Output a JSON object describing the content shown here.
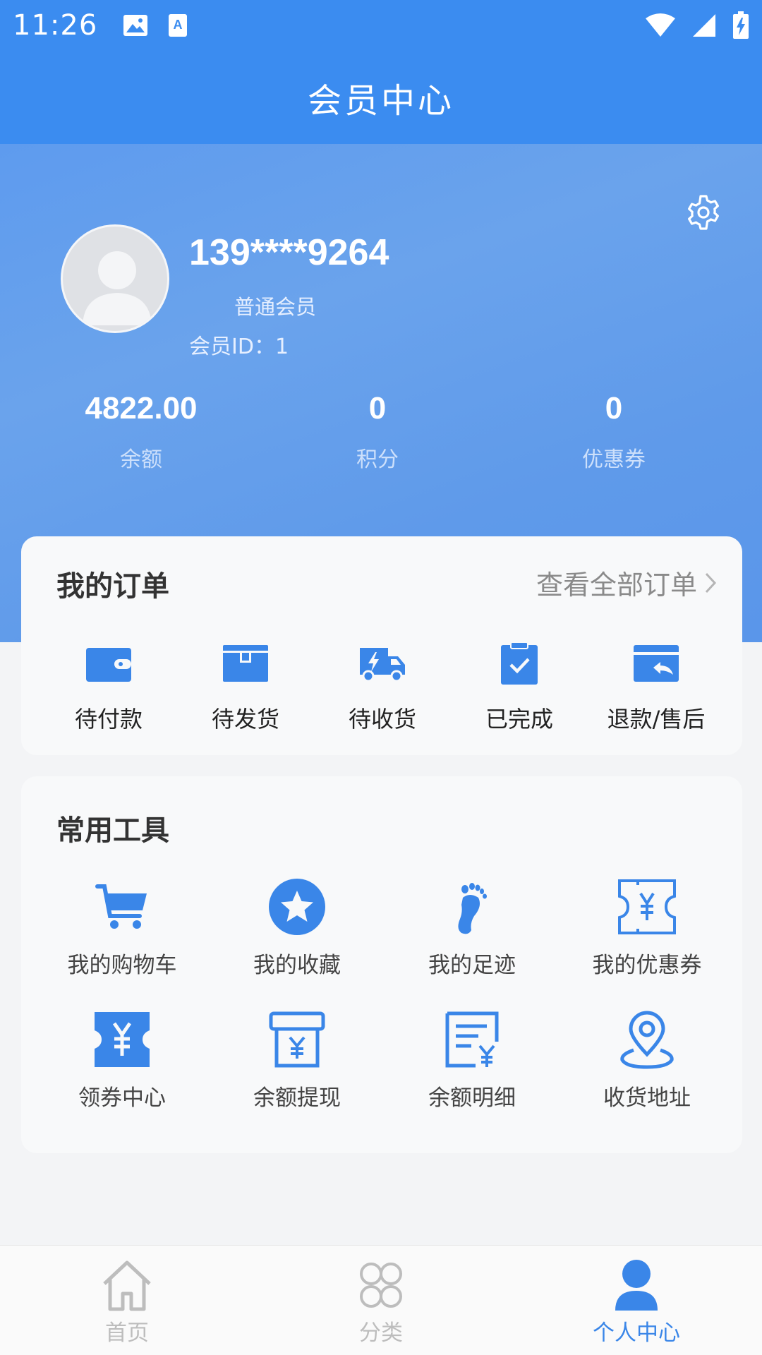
{
  "status_bar": {
    "time": "11:26"
  },
  "header": {
    "title": "会员中心"
  },
  "profile": {
    "phone": "139****9264",
    "level": "普通会员",
    "id_label": "会员ID：",
    "id_value": "1"
  },
  "stats": [
    {
      "value": "4822.00",
      "label": "余额"
    },
    {
      "value": "0",
      "label": "积分"
    },
    {
      "value": "0",
      "label": "优惠券"
    }
  ],
  "orders": {
    "title": "我的订单",
    "view_all": "查看全部订单",
    "items": [
      {
        "label": "待付款",
        "icon": "wallet-icon"
      },
      {
        "label": "待发货",
        "icon": "package-icon"
      },
      {
        "label": "待收货",
        "icon": "delivery-truck-icon"
      },
      {
        "label": "已完成",
        "icon": "clipboard-check-icon"
      },
      {
        "label": "退款/售后",
        "icon": "refund-card-icon"
      }
    ]
  },
  "tools": {
    "title": "常用工具",
    "items": [
      {
        "label": "我的购物车",
        "icon": "shopping-cart-icon"
      },
      {
        "label": "我的收藏",
        "icon": "star-icon"
      },
      {
        "label": "我的足迹",
        "icon": "footprint-icon"
      },
      {
        "label": "我的优惠券",
        "icon": "coupon-outline-icon"
      },
      {
        "label": "领券中心",
        "icon": "coupon-filled-icon"
      },
      {
        "label": "余额提现",
        "icon": "atm-withdraw-icon"
      },
      {
        "label": "余额明细",
        "icon": "bill-detail-icon"
      },
      {
        "label": "收货地址",
        "icon": "location-pin-icon"
      }
    ]
  },
  "bottom_nav": {
    "items": [
      {
        "label": "首页",
        "icon": "home-icon",
        "active": false
      },
      {
        "label": "分类",
        "icon": "category-grid-icon",
        "active": false
      },
      {
        "label": "个人中心",
        "icon": "user-icon",
        "active": true
      }
    ]
  },
  "colors": {
    "primary": "#3b8cf0",
    "icon_blue": "#3a86e8",
    "nav_inactive": "#bdbdbd",
    "nav_active": "#3a86e8"
  }
}
